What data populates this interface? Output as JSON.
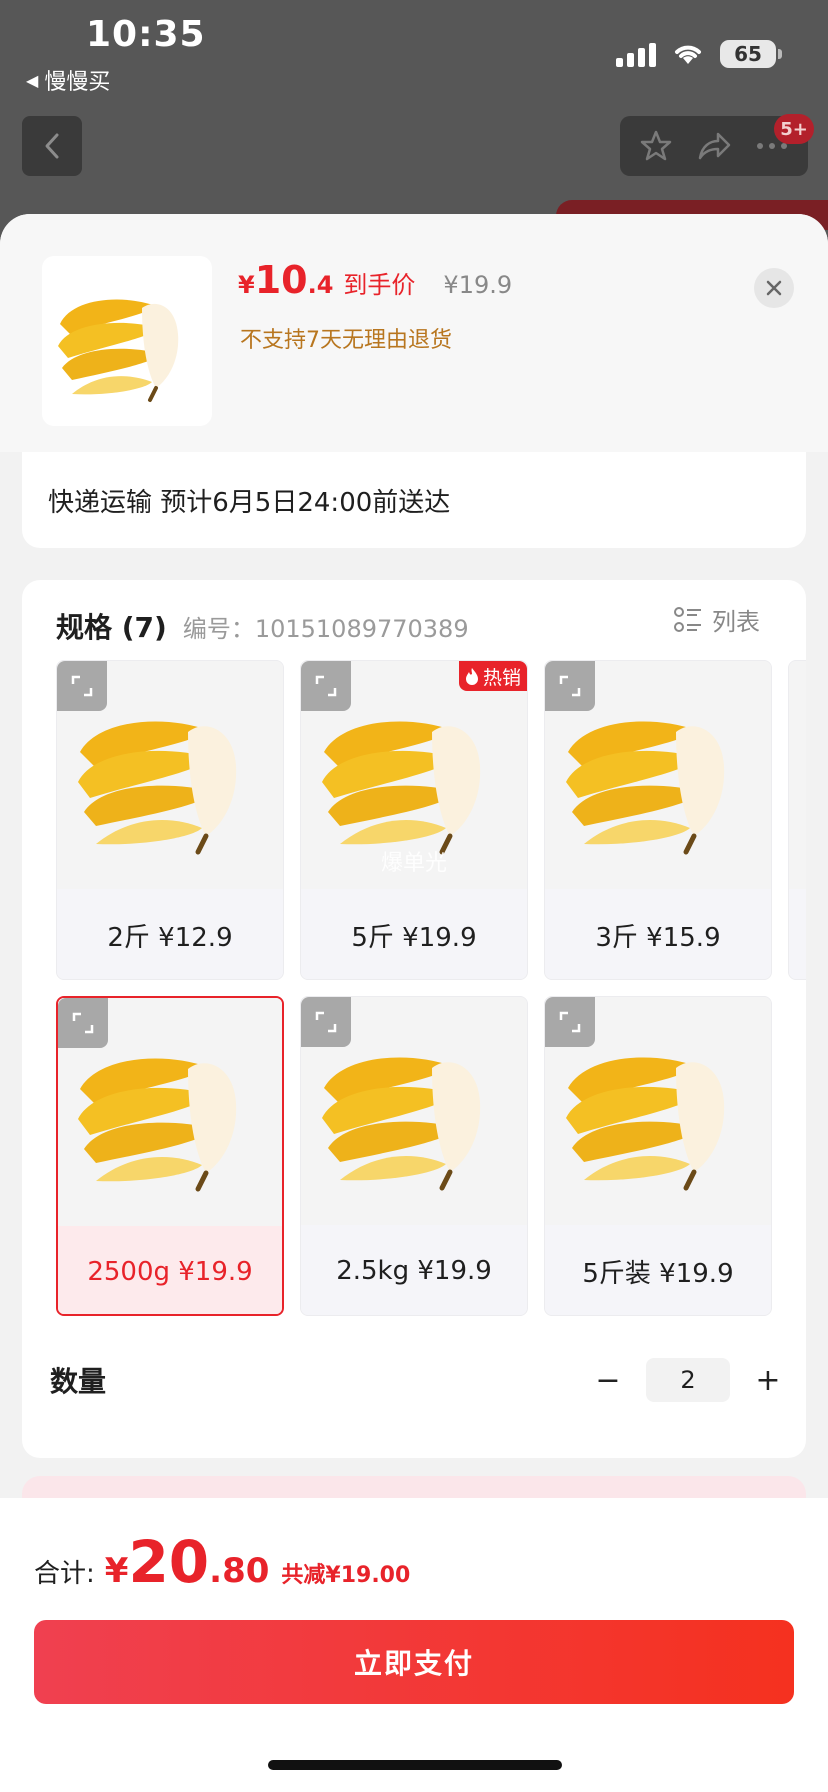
{
  "status_bar": {
    "time": "10:35",
    "back_app": "慢慢买",
    "battery": "65"
  },
  "header": {
    "notification_badge": "5+"
  },
  "product": {
    "price_currency": "¥",
    "price_int": "10",
    "price_dec": ".4",
    "price_label": "到手价",
    "original_price": "¥19.9",
    "return_note": "不支持7天无理由退货"
  },
  "delivery": {
    "text": "快递运输 预计6月5日24:00前送达"
  },
  "spec": {
    "title": "规格 (7)",
    "code": "编号：10151089770389",
    "list_label": "列表",
    "hot_label": "热销",
    "watermark": "爆单光",
    "options": [
      {
        "label": "2斤 ¥12.9",
        "selected": false
      },
      {
        "label": "5斤 ¥19.9",
        "selected": false,
        "hot": true
      },
      {
        "label": "3斤 ¥15.9",
        "selected": false
      },
      {
        "label": "2500g ¥19.9",
        "selected": true
      },
      {
        "label": "2.5kg ¥19.9",
        "selected": false
      },
      {
        "label": "5斤装 ¥19.9",
        "selected": false
      }
    ]
  },
  "quantity": {
    "label": "数量",
    "value": "2",
    "minus": "−",
    "plus": "+"
  },
  "bottom": {
    "total_label": "合计:",
    "total_currency": "¥",
    "total_int": "20",
    "total_dec": ".80",
    "savings": "共减¥19.00",
    "pay_label": "立即支付"
  },
  "colors": {
    "accent": "#e8232a",
    "warning": "#b8761f"
  },
  "icons": [
    "back-chevron-icon",
    "star-icon",
    "share-icon",
    "more-icon",
    "close-icon",
    "list-icon",
    "expand-icon",
    "fire-icon",
    "banana-image"
  ]
}
